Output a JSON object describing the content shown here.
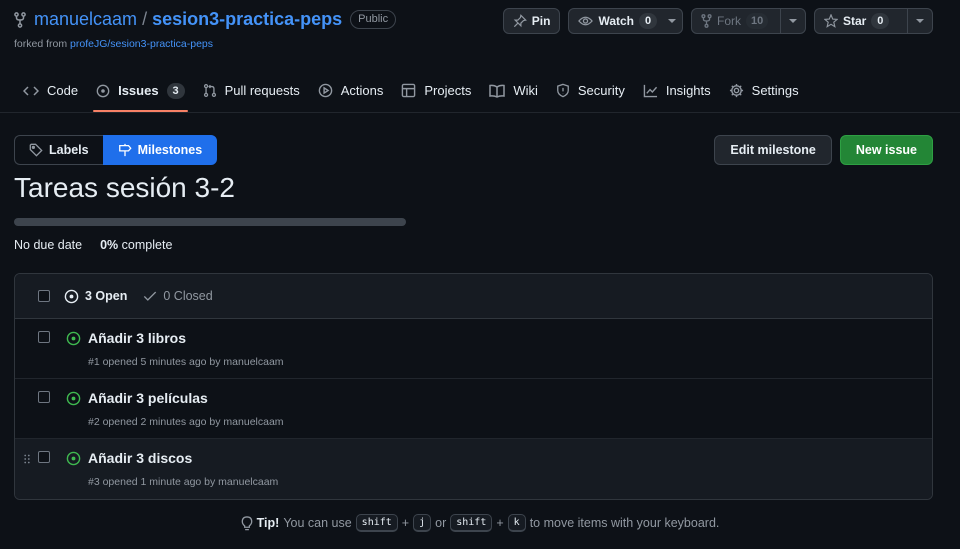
{
  "repo": {
    "owner": "manuelcaam",
    "separator": "/",
    "name": "sesion3-practica-peps",
    "visibility": "Public",
    "forked_prefix": "forked from",
    "forked_from": "profeJG/sesion3-practica-peps"
  },
  "actions": {
    "pin": "Pin",
    "watch": "Watch",
    "watch_count": "0",
    "fork": "Fork",
    "fork_count": "10",
    "star": "Star",
    "star_count": "0"
  },
  "tabs": [
    {
      "label": "Code",
      "icon": "code-icon"
    },
    {
      "label": "Issues",
      "icon": "issue-opened-icon",
      "count": "3",
      "selected": true
    },
    {
      "label": "Pull requests",
      "icon": "git-pull-request-icon"
    },
    {
      "label": "Actions",
      "icon": "play-icon"
    },
    {
      "label": "Projects",
      "icon": "table-icon"
    },
    {
      "label": "Wiki",
      "icon": "book-icon"
    },
    {
      "label": "Security",
      "icon": "shield-icon"
    },
    {
      "label": "Insights",
      "icon": "graph-icon"
    },
    {
      "label": "Settings",
      "icon": "gear-icon"
    }
  ],
  "subnav": {
    "labels": "Labels",
    "milestones": "Milestones"
  },
  "buttons": {
    "edit_milestone": "Edit milestone",
    "new_issue": "New issue"
  },
  "milestone": {
    "title": "Tareas sesión 3-2",
    "progress_fraction": 0,
    "due": "No due date",
    "percent": "0%",
    "complete_label": "complete"
  },
  "issues_header": {
    "open": "3 Open",
    "closed": "0 Closed"
  },
  "issues": [
    {
      "title": "Añadir 3 libros",
      "meta": "#1 opened 5 minutes ago by manuelcaam"
    },
    {
      "title": "Añadir 3 películas",
      "meta": "#2 opened 2 minutes ago by manuelcaam"
    },
    {
      "title": "Añadir 3 discos",
      "meta": "#3 opened 1 minute ago by manuelcaam"
    }
  ],
  "tip": {
    "label": "Tip!",
    "text1": "You can use",
    "key_shift": "shift",
    "plus": "+",
    "key_j": "j",
    "or": "or",
    "key_k": "k",
    "text2": "to move items with your keyboard."
  },
  "colors": {
    "accent": "#1f6feb",
    "link": "#4493f8",
    "open_green": "#3fb950",
    "primary_button": "#238636",
    "tab_underline": "#f78166"
  }
}
